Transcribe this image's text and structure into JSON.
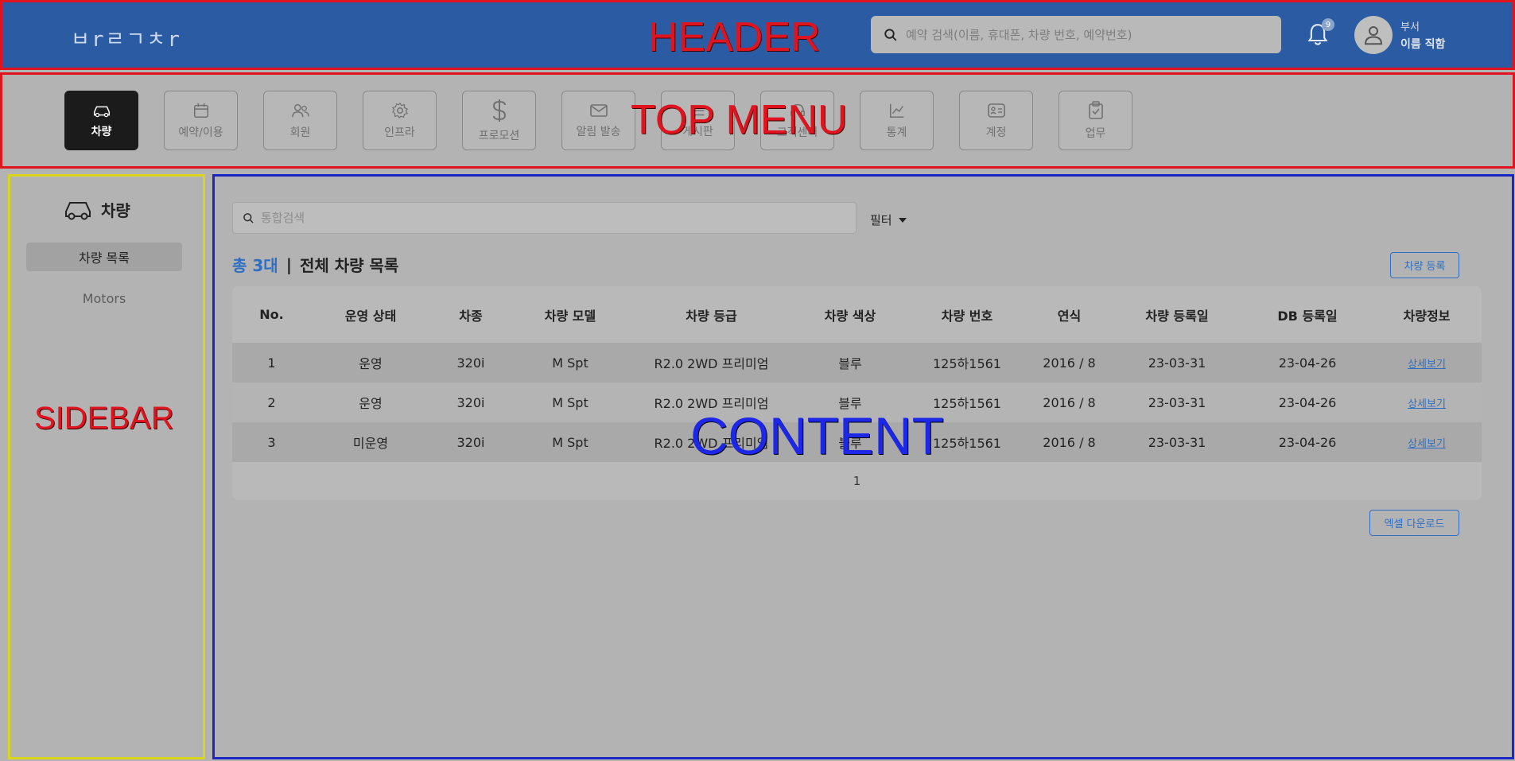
{
  "header": {
    "logo": "ㅂrㄹㄱㅊr",
    "overlay_label": "HEADER",
    "search_placeholder": "예약 검색(이름, 휴대폰, 차량 번호, 예약번호)",
    "notification_count": "9",
    "user_dept": "부서",
    "user_name": "이름 직함"
  },
  "topmenu": {
    "overlay_label": "TOP MENU",
    "items": [
      {
        "label": "차량",
        "icon": "car-icon",
        "active": true
      },
      {
        "label": "예약/이용",
        "icon": "calendar-icon"
      },
      {
        "label": "회원",
        "icon": "users-icon"
      },
      {
        "label": "인프라",
        "icon": "gear-icon"
      },
      {
        "label": "프로모션",
        "icon": "dollar-icon"
      },
      {
        "label": "알림 발송",
        "icon": "mail-icon"
      },
      {
        "label": "게시판",
        "icon": "list-icon"
      },
      {
        "label": "고객센터",
        "icon": "headset-icon"
      },
      {
        "label": "통계",
        "icon": "chart-icon"
      },
      {
        "label": "계정",
        "icon": "id-card-icon"
      },
      {
        "label": "업무",
        "icon": "clipboard-icon"
      }
    ]
  },
  "sidebar": {
    "overlay_label": "SIDEBAR",
    "title": "차량",
    "items": [
      {
        "label": "차량 목록",
        "active": true
      },
      {
        "label": "Motors"
      }
    ]
  },
  "content": {
    "overlay_label": "CONTENT",
    "search_placeholder": "통합검색",
    "filter_label": "필터",
    "count_label": "총 3대",
    "separator": "|",
    "list_title": "전체 차량 목록",
    "register_button": "차량 등록",
    "excel_button": "엑셀 다운로드",
    "table": {
      "headers": [
        "No.",
        "운영 상태",
        "차종",
        "차량 모델",
        "차량 등급",
        "차량 색상",
        "차량 번호",
        "연식",
        "차량 등록일",
        "DB 등록일",
        "차량정보"
      ],
      "rows": [
        [
          "1",
          "운영",
          "320i",
          "M Spt",
          "R2.0 2WD 프리미엄",
          "블루",
          "125하1561",
          "2016 / 8",
          "23-03-31",
          "23-04-26",
          "상세보기"
        ],
        [
          "2",
          "운영",
          "320i",
          "M Spt",
          "R2.0 2WD 프리미엄",
          "블루",
          "125하1561",
          "2016 / 8",
          "23-03-31",
          "23-04-26",
          "상세보기"
        ],
        [
          "3",
          "미운영",
          "320i",
          "M Spt",
          "R2.0 2WD 프리미엄",
          "블루",
          "125하1561",
          "2016 / 8",
          "23-03-31",
          "23-04-26",
          "상세보기"
        ]
      ]
    },
    "page": "1"
  },
  "colors": {
    "header_bg": "#2a5ba3",
    "accent": "#2f6fc3",
    "annotation_red": "#e0141e",
    "annotation_blue": "#1d27c4",
    "annotation_yellow": "#d8d51a"
  }
}
